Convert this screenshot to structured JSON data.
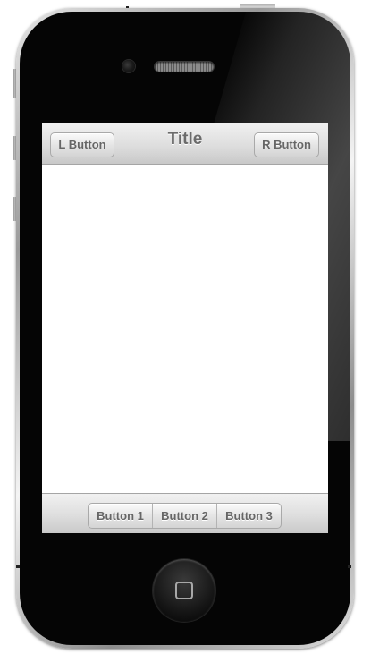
{
  "navbar": {
    "title": "Title",
    "left_button_label": "L Button",
    "right_button_label": "R Button"
  },
  "toolbar": {
    "buttons": [
      {
        "label": "Button 1"
      },
      {
        "label": "Button 2"
      },
      {
        "label": "Button 3"
      }
    ]
  },
  "device": {
    "model_style": "iphone-4",
    "frame_color": "#050505",
    "bar_gradient_top": "#f1f1f1",
    "bar_gradient_bottom": "#c9c9c9",
    "button_text_color": "#666666",
    "icons": [
      "front-camera-icon",
      "earpiece-speaker-icon",
      "home-square-icon"
    ]
  }
}
